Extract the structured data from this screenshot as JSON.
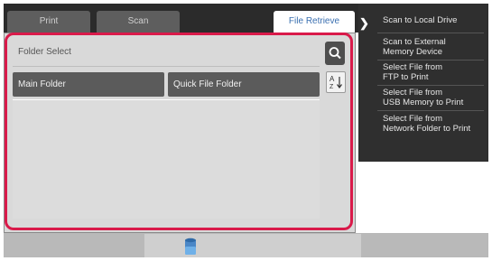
{
  "tabs": [
    {
      "label": "Print",
      "active": false
    },
    {
      "label": "Scan",
      "active": false
    },
    {
      "label": "File Retrieve",
      "active": true
    }
  ],
  "main": {
    "folder_select_label": "Folder Select",
    "folders": [
      "Main Folder",
      "Quick File Folder"
    ]
  },
  "tools": {
    "search_icon": "search-icon",
    "sort_icon": "sort-az-icon"
  },
  "side_menu": {
    "items": [
      "Scan to Local Drive",
      "Scan to External\nMemory Device",
      "Select File from\nFTP to Print",
      "Select File from\nUSB Memory to Print",
      "Select File from\nNetwork Folder to Print"
    ]
  },
  "footer": {
    "storage_icon": "storage-icon"
  },
  "colors": {
    "highlight": "#d91a4a",
    "active_tab_text": "#3a6fb0",
    "side_menu_bg": "#2f2f2f",
    "folder_button_bg": "#5b5b5b"
  }
}
